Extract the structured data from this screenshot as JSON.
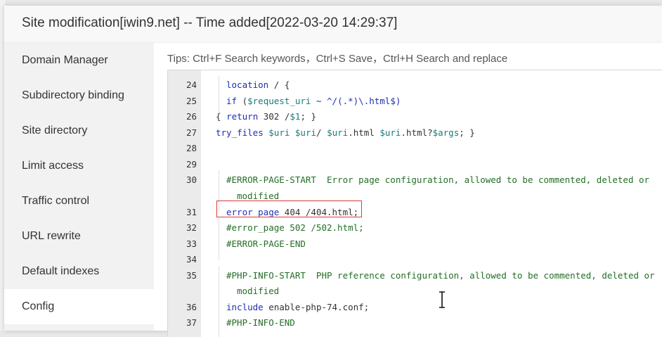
{
  "dialog": {
    "title": "Site modification[iwin9.net] -- Time added[2022-03-20 14:29:37]"
  },
  "sidebar": {
    "items": [
      {
        "label": "Domain Manager"
      },
      {
        "label": "Subdirectory binding"
      },
      {
        "label": "Site directory"
      },
      {
        "label": "Limit access"
      },
      {
        "label": "Traffic control"
      },
      {
        "label": "URL rewrite"
      },
      {
        "label": "Default indexes"
      },
      {
        "label": "Config"
      }
    ],
    "active": "Config"
  },
  "tips": "Tips:  Ctrl+F Search keywords，Ctrl+S Save，Ctrl+H Search and replace",
  "editor": {
    "line_numbers": [
      "24",
      "25",
      "26",
      "27",
      "28",
      "29",
      "30",
      "",
      "31",
      "32",
      "33",
      "34",
      "35",
      "",
      "36",
      "37"
    ],
    "lines": {
      "l24_kw": "location",
      "l24_rest": " / {",
      "l25_kw": "if",
      "l25_open": " (",
      "l25_var": "$request_uri",
      "l25_rest": " ~ ^/(.*)\\.html$)",
      "l26_open": "{ ",
      "l26_kw": "return",
      "l26_mid": " 302 /",
      "l26_var": "$1",
      "l26_rest": "; }",
      "l27_kw": "try_files",
      "l27_sp1": " ",
      "l27_v1": "$uri",
      "l27_sp2": " ",
      "l27_v2": "$uri",
      "l27_sp3": "/ ",
      "l27_v3": "$uri",
      "l27_mid": ".html ",
      "l27_v4": "$uri",
      "l27_mid2": ".html?",
      "l27_v5": "$args",
      "l27_rest": "; }",
      "l30a": "#ERROR-PAGE-START  Error page configuration, allowed to be commented, deleted or",
      "l30b": "modified",
      "l31_kw": "error_page",
      "l31_rest": " 404 /404.html;",
      "l32": "#error_page 502 /502.html;",
      "l33": "#ERROR-PAGE-END",
      "l35a": "#PHP-INFO-START  PHP reference configuration, allowed to be commented, deleted or",
      "l35b": "modified",
      "l36_kw": "include",
      "l36_rest": " enable-php-74.conf;",
      "l37": "#PHP-INFO-END"
    }
  },
  "colors": {
    "keyword": "#1c2fb5",
    "variable": "#1a7a7a",
    "comment": "#236e25",
    "highlight_border": "#d93a3a"
  },
  "icons": {
    "cursor": "text-cursor-icon"
  }
}
